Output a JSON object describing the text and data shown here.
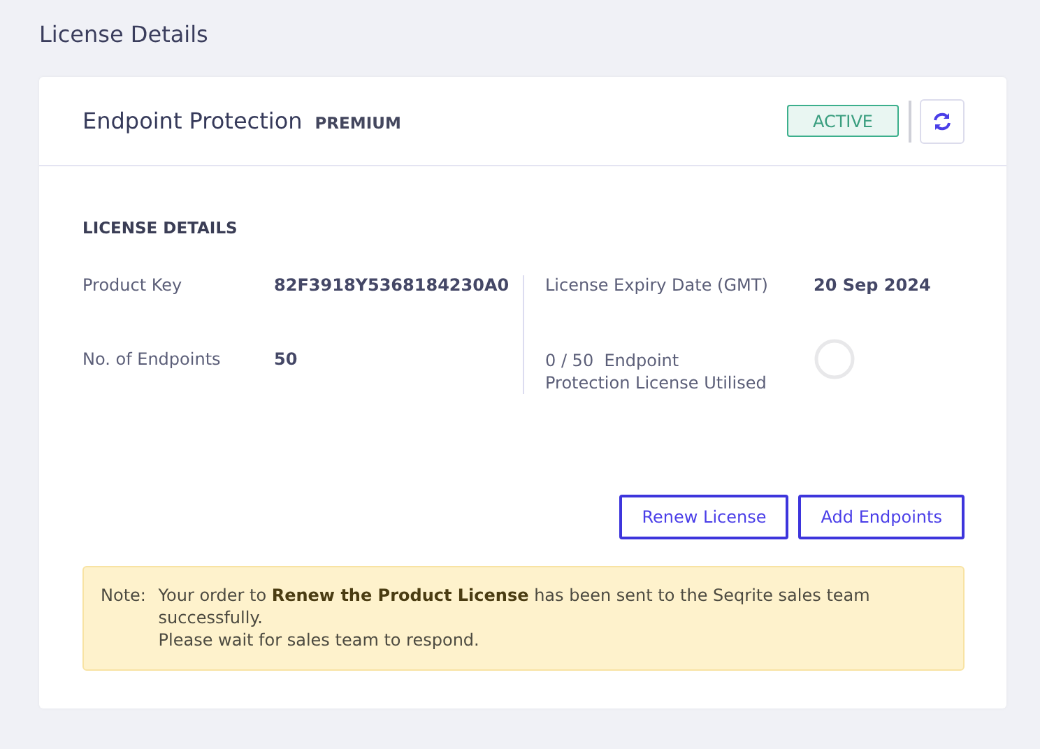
{
  "page_title": "License Details",
  "product": {
    "name": "Endpoint Protection",
    "edition": "PREMIUM",
    "status": "ACTIVE"
  },
  "section_title": "LICENSE DETAILS",
  "fields": [
    {
      "label": "Product Key",
      "value": "82F3918Y5368184230A0"
    },
    {
      "label": "No. of Endpoints",
      "value": "50"
    }
  ],
  "right_fields": [
    {
      "label": "License Expiry Date (GMT)",
      "value": "20 Sep 2024"
    }
  ],
  "usage": {
    "count": "0 / 50",
    "label": "Endpoint Protection License Utilised",
    "level": 0
  },
  "buttons": [
    "Renew License",
    "Add Endpoints"
  ],
  "note": {
    "label": "Note:",
    "lines": [
      "Your order to **Renew the Product License** has been sent to the Seqrite sales team successfully.",
      "Please wait for sales team to respond."
    ]
  }
}
